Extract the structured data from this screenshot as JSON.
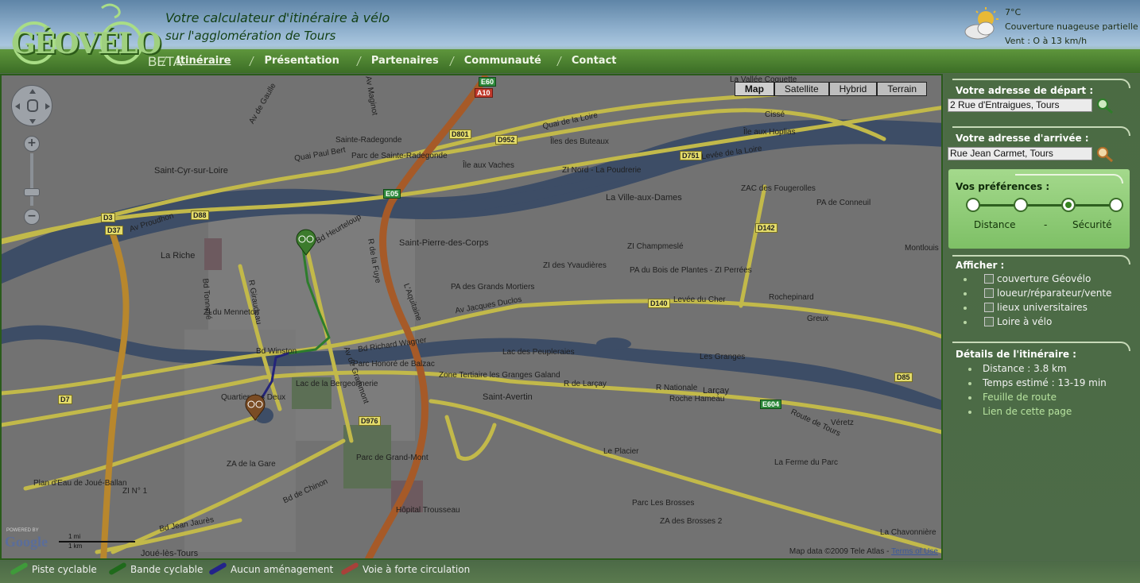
{
  "header": {
    "logo_text": "GÉOVÉLO",
    "beta": "BETA",
    "tagline_line1": "Votre calculateur d'itinéraire à vélo",
    "tagline_line2": "sur l'agglomération de Tours",
    "weather": {
      "icon": "partly-cloudy-icon",
      "temperature": "7°C",
      "condition": "Couverture nuageuse partielle",
      "wind": "Vent : O à 13 km/h"
    },
    "nav": [
      {
        "label": "Itinéraire",
        "active": true
      },
      {
        "label": "Présentation",
        "active": false
      },
      {
        "label": "Partenaires",
        "active": false
      },
      {
        "label": "Communauté",
        "active": false
      },
      {
        "label": "Contact",
        "active": false
      }
    ]
  },
  "map": {
    "map_types": [
      "Map",
      "Satellite",
      "Hybrid",
      "Terrain"
    ],
    "active_map_type": "Map",
    "zoom_in": "+",
    "zoom_out": "−",
    "powered_by": "POWERED BY",
    "google": "Google",
    "scale_mi": "1 mi",
    "scale_km": "1 km",
    "attribution": "Map data ©2009 Tele Atlas -",
    "terms": "Terms of Use",
    "places": [
      "Saint-Cyr-sur-Loire",
      "Sainte-Radegonde",
      "Saint-Pierre-des-Corps",
      "La Ville-aux-Dames",
      "La Riche",
      "Saint-Avertin",
      "Larçay",
      "Joué-lès-Tours",
      "Rochepinard",
      "Greux",
      "Véretz",
      "Montlouis",
      "Les Granges",
      "Roche Hameau",
      "Le Placier",
      "La Ferme du Parc",
      "La Chavonnière",
      "Quartier des Deux",
      "Hôpital Trousseau",
      "Parc de Grand-Mont",
      "ZA de la Gare",
      "ZI N° 1",
      "ZI du Menneton",
      "Parc de Sainte-Radegonde",
      "Lac de la Bergeonnerie",
      "Lac des Peupleraies",
      "Parc Honoré de Balzac",
      "PA des Grands Mortiers",
      "ZI Champmeslé",
      "PA du Bois de Plantes - ZI Perrées",
      "ZI des Yvaudières",
      "ZAC des Fougerolles",
      "PA de Conneuil",
      "ZI Nord - La Poudrerie",
      "Île aux Vaches",
      "Îles des Buteaux",
      "Île aux Hoplias",
      "Plan d'Eau de Joué-Ballan",
      "Zone Tertiaire les Granges Galand",
      "Parc Les Brosses",
      "ZA des Brosses 2",
      "La Vallée Coquette",
      "Cissé"
    ],
    "roads": [
      "Quai de la Loire",
      "Quai Paul Bert",
      "Levée de la Loire",
      "Levée du Cher",
      "Av Jacques Duclos",
      "Bd Richard Wagner",
      "Bd Winston",
      "Av de Grammont",
      "R de Larçay",
      "R Nationale",
      "Route de Tours",
      "Bd de Chinon",
      "Bd Jean Jaurès",
      "Av Proudhon",
      "L'Aquitaine",
      "Bd Heurteloup",
      "Bd Tonnellé",
      "R Giraudeau",
      "R de la Fuye",
      "Av de Gaulle",
      "Av Maginot"
    ],
    "shields": [
      "E60",
      "A10",
      "D801",
      "D952",
      "D751",
      "D142",
      "D3",
      "D37",
      "D88",
      "E05",
      "D140",
      "D7",
      "D976",
      "E604",
      "D85"
    ]
  },
  "side": {
    "start_title": "Votre adresse de départ :",
    "start_value": "2 Rue d'Entraigues, Tours",
    "end_title": "Votre adresse d'arrivée :",
    "end_value": "Rue Jean Carmet, Tours",
    "prefs_title": "Vos préférences :",
    "pref_distance": "Distance",
    "pref_sep": "-",
    "pref_security": "Sécurité",
    "pref_selected_stop": 3,
    "show_title": "Afficher :",
    "show_options": [
      "couverture Géovélo",
      "loueur/réparateur/vente",
      "lieux universitaires",
      "Loire à vélo"
    ],
    "details_title": "Détails de l'itinéraire :",
    "distance": "Distance : 3.8 km",
    "time": "Temps estimé : 13-19 min",
    "roadmap_link": "Feuille de route",
    "page_link": "Lien de cette page"
  },
  "legend": [
    {
      "label": "Piste cyclable",
      "color": "#3f9a3a"
    },
    {
      "label": "Bande cyclable",
      "color": "#1f6a1b"
    },
    {
      "label": "Aucun aménagement",
      "color": "#23238a"
    },
    {
      "label": "Voie à forte circulation",
      "color": "#a8413a"
    }
  ]
}
